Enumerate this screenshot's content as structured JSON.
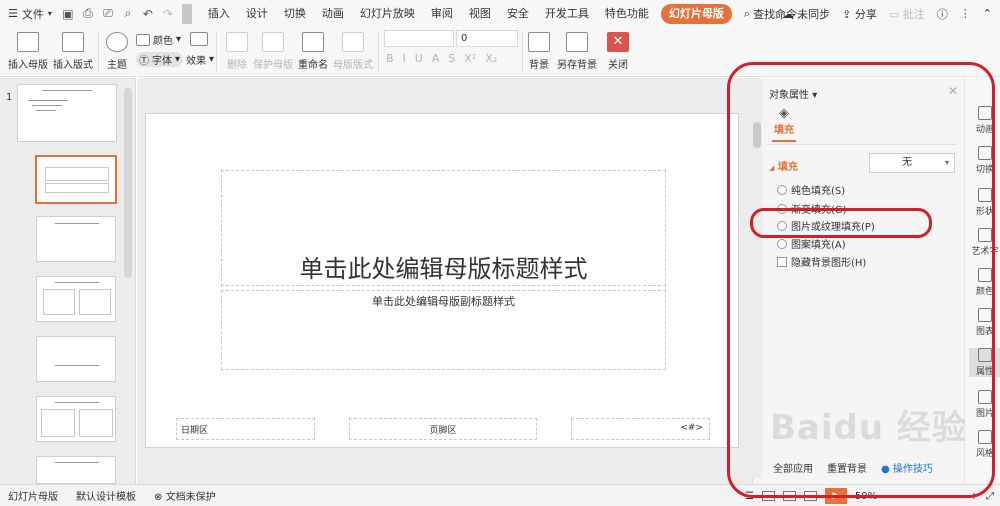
{
  "menubar": {
    "file_label": "文件",
    "tabs": [
      "插入",
      "设计",
      "切换",
      "动画",
      "幻灯片放映",
      "审阅",
      "视图",
      "安全",
      "开发工具",
      "特色功能"
    ],
    "active_tab": "幻灯片母版",
    "search": "查找命令...",
    "sync": "未同步",
    "share": "分享",
    "annotate": "批注"
  },
  "ribbon": {
    "insert_master": "插入母版",
    "insert_layout": "插入版式",
    "theme": "主题",
    "color": "颜色",
    "font": "字体",
    "effect": "效果",
    "delete": "删除",
    "protect_master": "保护母版",
    "rename": "重命名",
    "master_layout": "母版版式",
    "font_size": "0",
    "background": "背景",
    "save_background": "另存背景",
    "close": "关闭"
  },
  "thumbnails": {
    "master_number": "1"
  },
  "slide": {
    "title": "单击此处编辑母版标题样式",
    "subtitle": "单击此处编辑母版副标题样式",
    "date_area": "日期区",
    "footer_area": "页脚区",
    "page_num": "<#>"
  },
  "property_panel": {
    "title": "对象属性",
    "tab_fill": "填充",
    "section_fill": "填充",
    "fill_value": "无",
    "options": [
      "纯色填充(S)",
      "渐变填充(G)",
      "图片或纹理填充(P)",
      "图案填充(A)"
    ],
    "hide_bg_shapes": "隐藏背景图形(H)",
    "apply_all": "全部应用",
    "reset_bg": "重置背景",
    "tips": "操作技巧"
  },
  "side_tools": [
    "动画",
    "切换",
    "形状",
    "艺术字",
    "颜色",
    "图表",
    "属性",
    "图片",
    "风格"
  ],
  "status": {
    "mode": "幻灯片母版",
    "template": "默认设计模板",
    "protect": "文档未保护",
    "zoom": "59%"
  },
  "watermark": "Baidu 经验"
}
